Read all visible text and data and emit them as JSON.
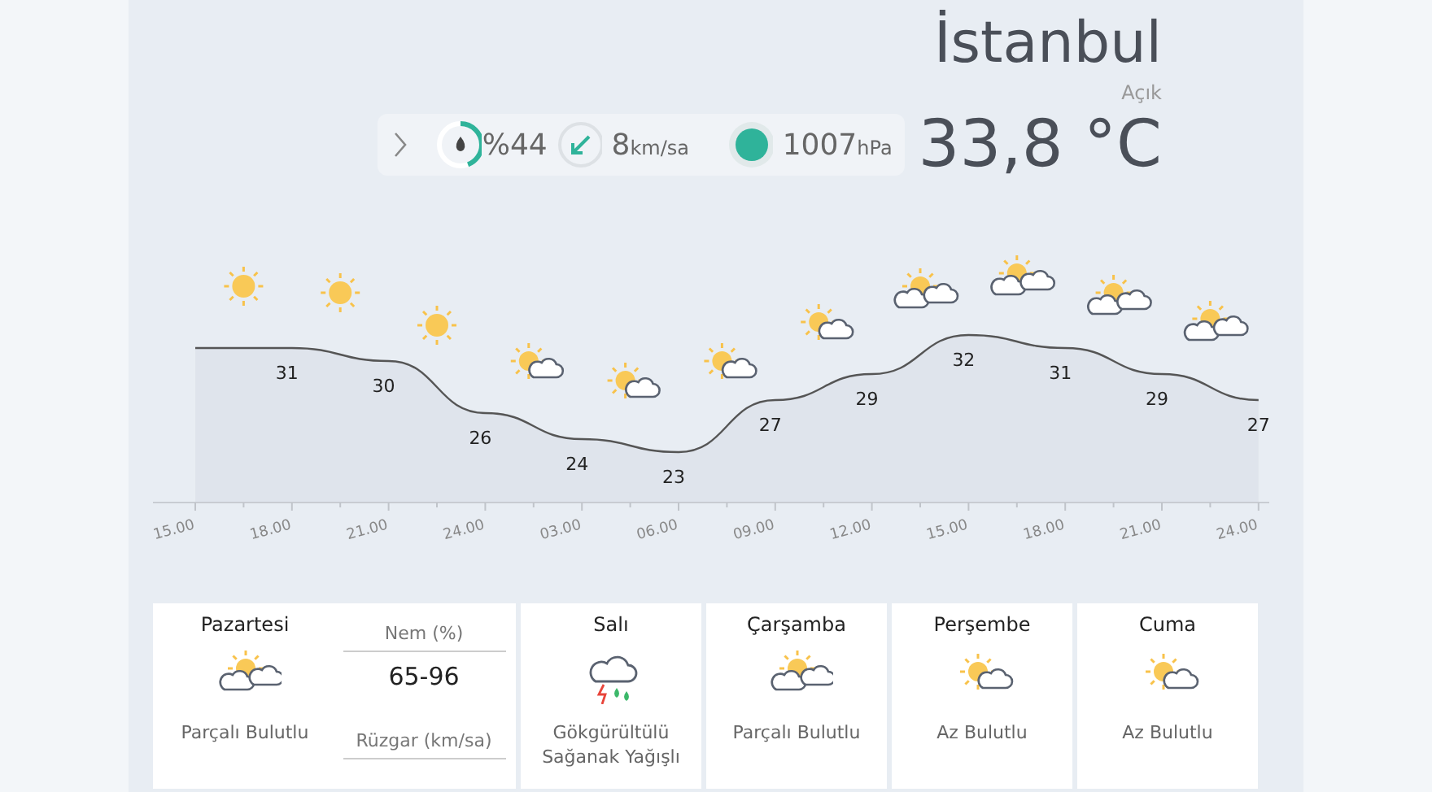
{
  "city": "İstanbul",
  "condition": "Açık",
  "stats": {
    "humidity": {
      "text": "%44",
      "level": 0.44
    },
    "wind": {
      "value": "8",
      "unit": "km/sa"
    },
    "pressure": {
      "value": "1007",
      "unit": "hPa"
    }
  },
  "temperature": "33,8 °C",
  "hourly": {
    "icons": [
      {
        "kind": "sun"
      },
      {
        "kind": "sun"
      },
      {
        "kind": "sun"
      },
      {
        "kind": "sun_cloud"
      },
      {
        "kind": "sun_cloud"
      },
      {
        "kind": "sun_cloud"
      },
      {
        "kind": "sun_cloud"
      },
      {
        "kind": "sun_clouds"
      },
      {
        "kind": "sun_clouds"
      },
      {
        "kind": "sun_clouds"
      },
      {
        "kind": "sun_clouds"
      }
    ],
    "chart_data": {
      "type": "area",
      "x": [
        "15.00",
        "18.00",
        "21.00",
        "24.00",
        "03.00",
        "06.00",
        "09.00",
        "12.00",
        "15.00",
        "18.00",
        "21.00",
        "24.00"
      ],
      "values": [
        31,
        31,
        30,
        26,
        24,
        23,
        27,
        29,
        32,
        31,
        29,
        27
      ],
      "value_labels": [
        null,
        "31",
        "30",
        "26",
        "24",
        "23",
        "27",
        "29",
        "32",
        "31",
        "29",
        "27"
      ]
    }
  },
  "days": [
    {
      "name": "Pazartesi",
      "kind": "sun_clouds",
      "summary": "Parçalı Bulutlu",
      "details": [
        {
          "label": "Nem (%)",
          "value": "65-96"
        },
        {
          "label": "Rüzgar (km/sa)"
        }
      ]
    },
    {
      "name": "Salı",
      "kind": "storm",
      "summary": "Gökgürültülü Sağanak Yağışlı"
    },
    {
      "name": "Çarşamba",
      "kind": "sun_clouds",
      "summary": "Parçalı Bulutlu"
    },
    {
      "name": "Perşembe",
      "kind": "sun_cloud",
      "summary": "Az Bulutlu"
    },
    {
      "name": "Cuma",
      "kind": "sun_cloud",
      "summary": "Az Bulutlu"
    }
  ]
}
